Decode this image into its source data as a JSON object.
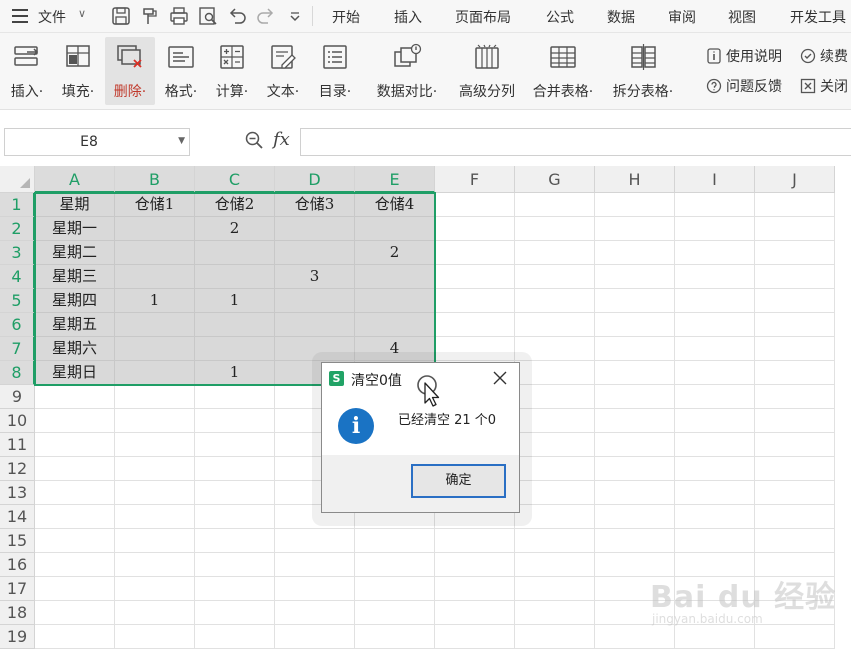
{
  "menubar": {
    "file_label": "文件",
    "tabs": [
      "开始",
      "插入",
      "页面布局",
      "公式",
      "数据",
      "审阅",
      "视图",
      "开发工具"
    ]
  },
  "ribbon": {
    "buttons": [
      {
        "label": "插入·",
        "icon": "insert-rows-icon"
      },
      {
        "label": "填充·",
        "icon": "fill-icon"
      },
      {
        "label": "删除·",
        "icon": "delete-icon"
      },
      {
        "label": "格式·",
        "icon": "format-icon"
      },
      {
        "label": "计算·",
        "icon": "calculate-icon"
      },
      {
        "label": "文本·",
        "icon": "text-edit-icon"
      },
      {
        "label": "目录·",
        "icon": "toc-icon"
      },
      {
        "label": "数据对比·",
        "icon": "data-compare-icon"
      },
      {
        "label": "高级分列",
        "icon": "split-columns-icon"
      },
      {
        "label": "合并表格·",
        "icon": "merge-tables-icon"
      },
      {
        "label": "拆分表格·",
        "icon": "split-table-icon"
      }
    ],
    "help_label": "使用说明",
    "renew_label": "续费",
    "feedback_label": "问题反馈",
    "close_label": "关闭"
  },
  "formula_bar": {
    "name_box": "E8",
    "fx": "fx",
    "value": ""
  },
  "sheet": {
    "columns": [
      "A",
      "B",
      "C",
      "D",
      "E",
      "F",
      "G",
      "H",
      "I",
      "J"
    ],
    "rows": [
      "1",
      "2",
      "3",
      "4",
      "5",
      "6",
      "7",
      "8",
      "9",
      "10",
      "11",
      "12",
      "13",
      "14",
      "15",
      "16",
      "17",
      "18",
      "19"
    ],
    "data": [
      [
        "星期",
        "仓储1",
        "仓储2",
        "仓储3",
        "仓储4"
      ],
      [
        "星期一",
        "",
        "2",
        "",
        ""
      ],
      [
        "星期二",
        "",
        "",
        "",
        "2"
      ],
      [
        "星期三",
        "",
        "",
        "3",
        ""
      ],
      [
        "星期四",
        "1",
        "1",
        "",
        ""
      ],
      [
        "星期五",
        "",
        "",
        "",
        ""
      ],
      [
        "星期六",
        "",
        "",
        "",
        "4"
      ],
      [
        "星期日",
        "",
        "1",
        "",
        ""
      ]
    ]
  },
  "dialog": {
    "logo": "S",
    "title": "清空0值",
    "message": "已经清空 21 个0",
    "ok_label": "确定"
  },
  "watermark": {
    "text": "Bai du 经验",
    "sub": "jingyan.baidu.com"
  }
}
